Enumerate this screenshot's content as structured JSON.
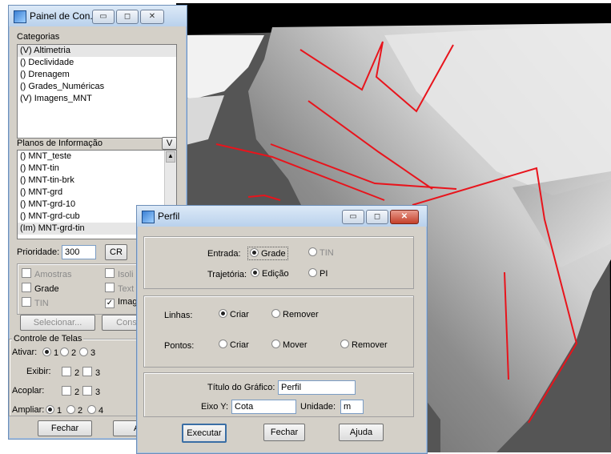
{
  "panel": {
    "title": "Painel de Con...",
    "categorias_label": "Categorias",
    "categorias": [
      "(V) Altimetria",
      "() Declividade",
      "() Drenagem",
      "() Grades_Numéricas",
      "(V) Imagens_MNT"
    ],
    "planos_label": "Planos de Informação",
    "planos_v": "V",
    "planos": [
      "() MNT_teste",
      "() MNT-tin",
      "() MNT-tin-brk",
      "() MNT-grd",
      "() MNT-grd-10",
      "() MNT-grd-cub",
      "(Im) MNT-grd-tin"
    ],
    "prioridade_label": "Prioridade:",
    "prioridade_value": "300",
    "cr_label": "CR",
    "checks": [
      {
        "label": "Amostras",
        "checked": false,
        "grey": true
      },
      {
        "label": "Isoli",
        "checked": false,
        "grey": true
      },
      {
        "label": "Grade",
        "checked": false,
        "grey": false
      },
      {
        "label": "Text",
        "checked": false,
        "grey": true
      },
      {
        "label": "TIN",
        "checked": false,
        "grey": true
      },
      {
        "label": "Imag",
        "checked": true,
        "grey": false
      }
    ],
    "selecionar_label": "Selecionar...",
    "cons_label": "Cons",
    "controle_label": "Controle de Telas",
    "ativar_label": "Ativar:",
    "ativar_options": [
      "1",
      "2",
      "3"
    ],
    "exibir_label": "Exibir:",
    "exibir_options": [
      "2",
      "3"
    ],
    "acoplar_label": "Acoplar:",
    "acoplar_options": [
      "2",
      "3"
    ],
    "ampliar_label": "Ampliar:",
    "ampliar_options": [
      "1",
      "2",
      "4"
    ],
    "fechar_label": "Fechar",
    "ajuda_label": "Aju"
  },
  "perfil": {
    "title": "Perfil",
    "entrada_label": "Entrada:",
    "entrada_grade": "Grade",
    "entrada_tin": "TIN",
    "trajetoria_label": "Trajetória:",
    "trajetoria_edicao": "Edição",
    "trajetoria_pi": "PI",
    "linhas_label": "Linhas:",
    "linhas_criar": "Criar",
    "linhas_remover": "Remover",
    "pontos_label": "Pontos:",
    "pontos_criar": "Criar",
    "pontos_mover": "Mover",
    "pontos_remover": "Remover",
    "titulo_label": "Título do Gráfico:",
    "titulo_value": "Perfil",
    "eixo_label": "Eixo Y:",
    "eixo_value": "Cota",
    "unidade_label": "Unidade:",
    "unidade_value": "m",
    "executar_label": "Executar",
    "fechar_label": "Fechar",
    "ajuda_label": "Ajuda"
  },
  "colors": {
    "profile_line": "#e8141c",
    "window_bg": "#d4d0c8"
  }
}
